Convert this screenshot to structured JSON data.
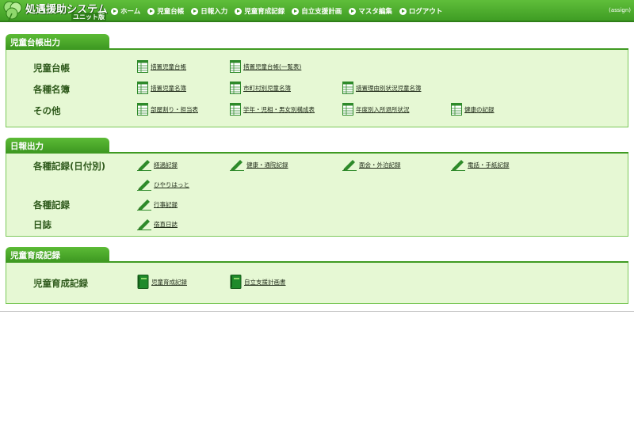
{
  "header": {
    "app_title": "処遇援助システム",
    "app_subtitle": "ユニット版",
    "user": "(assign)",
    "nav": [
      "ホーム",
      "児童台帳",
      "日報入力",
      "児童育成記録",
      "自立支援計画",
      "マスタ編集",
      "ログアウト"
    ]
  },
  "sections": {
    "register": {
      "title": "児童台帳出力",
      "rows": [
        {
          "label": "児童台帳",
          "links": [
            "措置児童台帳",
            "措置児童台帳(一覧表)"
          ]
        },
        {
          "label": "各種名簿",
          "links": [
            "措置児童名簿",
            "市町村別児童名簿",
            "措置理由別状況児童名簿"
          ]
        },
        {
          "label": "その他",
          "links": [
            "部屋割り・担当表",
            "学年・児相・男女別構成表",
            "年度別入所退所状況",
            "健康の記録"
          ]
        }
      ]
    },
    "daily": {
      "title": "日報出力",
      "rows": [
        {
          "label": "各種記録(日付別)",
          "links": [
            "経過記録",
            "健康・通院記録",
            "面会・外泊記録",
            "電話・手紙記録",
            "ひやりはっと"
          ]
        },
        {
          "label": "各種記録",
          "links": [
            "行事記録"
          ]
        },
        {
          "label": "日誌",
          "links": [
            "宿直日誌"
          ]
        }
      ]
    },
    "growth": {
      "title": "児童育成記録",
      "rows": [
        {
          "label": "児童育成記録",
          "links": [
            "児童育成記録",
            "自立支援計画書"
          ]
        }
      ]
    }
  },
  "colors": {
    "header_green": "#3f9d24",
    "panel_bg": "#e6f8d4",
    "panel_border": "#7cc85a",
    "label_text": "#2f5a1c"
  },
  "icons": {
    "table": "spreadsheet-icon",
    "pen": "pen-icon",
    "book": "book-icon"
  }
}
